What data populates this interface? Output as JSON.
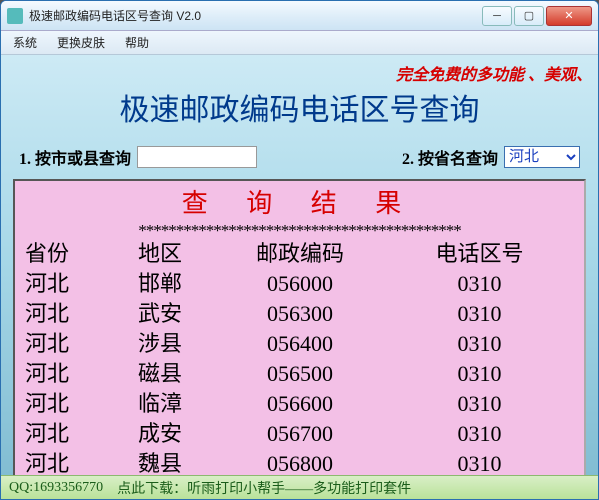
{
  "window_title": "极速邮政编码电话区号查询 V2.0",
  "menu": {
    "system": "系统",
    "skin": "更换皮肤",
    "help": "帮助"
  },
  "marquee_text": "完全免费的多功能 、美观、 ",
  "app_title": "极速邮政编码电话区号查询",
  "query": {
    "label1": "1. 按市或县查询",
    "input_value": "",
    "label2": "2. 按省名查询",
    "province_selected": "河北"
  },
  "result_title": "查 询 结 果",
  "stars": "*******************************************",
  "columns": {
    "province": "省份",
    "area": "地区",
    "postcode": "邮政编码",
    "areacode": "电话区号"
  },
  "rows": [
    {
      "province": "河北",
      "area": "邯郸",
      "postcode": "056000",
      "areacode": "0310"
    },
    {
      "province": "河北",
      "area": "武安",
      "postcode": "056300",
      "areacode": "0310"
    },
    {
      "province": "河北",
      "area": "涉县",
      "postcode": "056400",
      "areacode": "0310"
    },
    {
      "province": "河北",
      "area": "磁县",
      "postcode": "056500",
      "areacode": "0310"
    },
    {
      "province": "河北",
      "area": "临漳",
      "postcode": "056600",
      "areacode": "0310"
    },
    {
      "province": "河北",
      "area": "成安",
      "postcode": "056700",
      "areacode": "0310"
    },
    {
      "province": "河北",
      "area": "魏县",
      "postcode": "056800",
      "areacode": "0310"
    }
  ],
  "footer": {
    "qq": "QQ:1693356770",
    "link": "点此下载：听雨打印小帮手——多功能打印套件"
  }
}
